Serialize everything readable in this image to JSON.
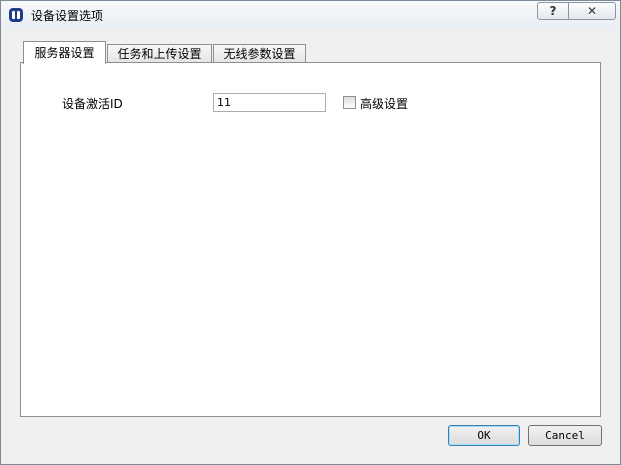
{
  "window": {
    "title": "设备设置选项",
    "help_label": "?",
    "close_label": "✕"
  },
  "tabs": [
    {
      "label": "服务器设置",
      "active": true
    },
    {
      "label": "任务和上传设置",
      "active": false
    },
    {
      "label": "无线参数设置",
      "active": false
    }
  ],
  "server_settings": {
    "activation_id_label": "设备激活ID",
    "activation_id_value": "11",
    "advanced_label": "高级设置",
    "advanced_checked": false
  },
  "buttons": {
    "ok": "OK",
    "cancel": "Cancel"
  }
}
